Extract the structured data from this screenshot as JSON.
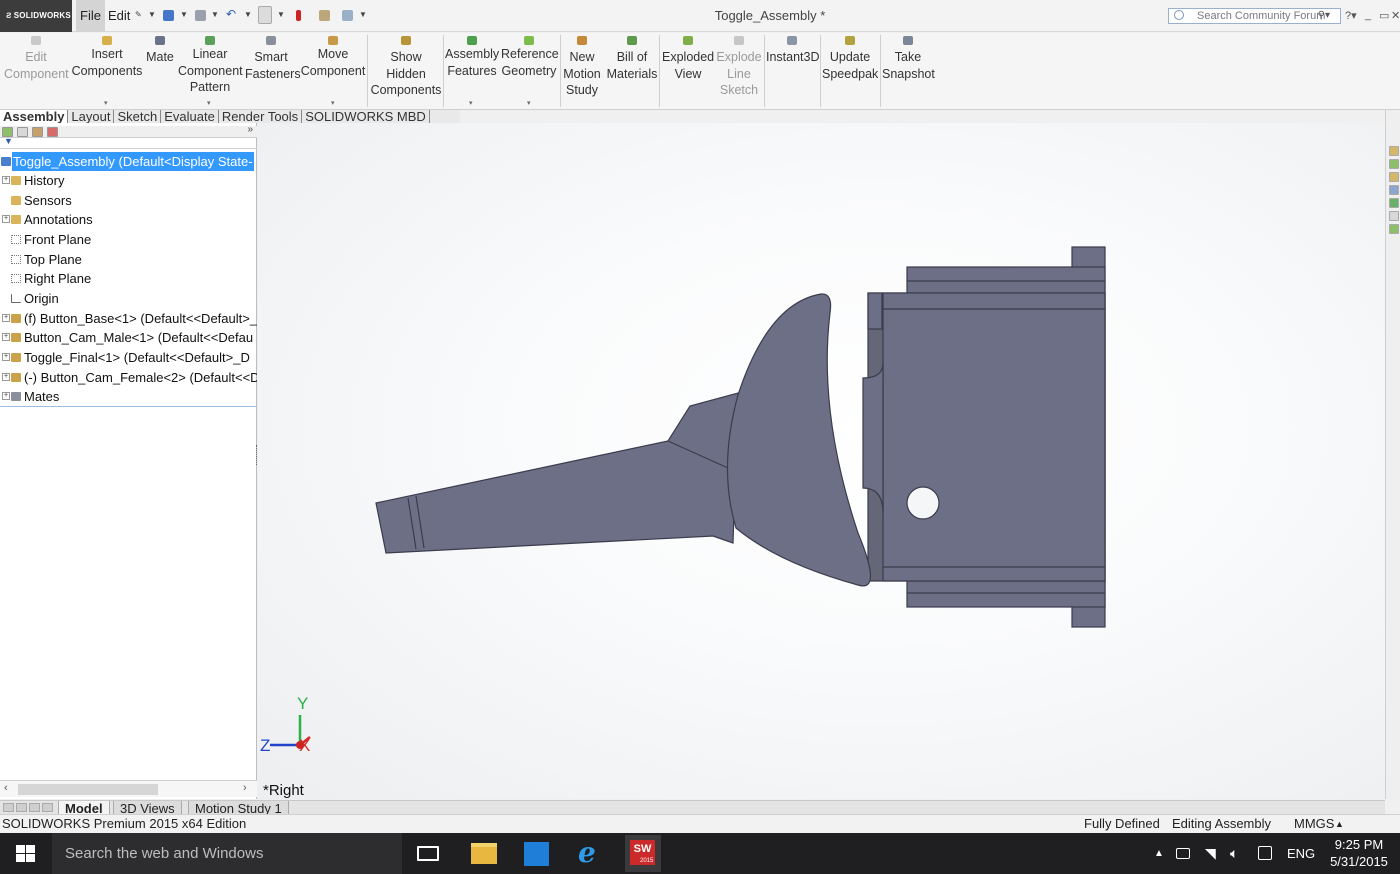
{
  "app": {
    "logo_text": "SOLIDWORKS",
    "document_title": "Toggle_Assembly *"
  },
  "menus": [
    "File",
    "Edit"
  ],
  "search": {
    "placeholder": "Search Community Forum"
  },
  "command_manager": {
    "commands": [
      {
        "label": "Edit Component",
        "enabled": false,
        "icon": "edit-component-icon"
      },
      {
        "label": "Insert Components",
        "enabled": true,
        "icon": "insert-components-icon"
      },
      {
        "label": "Mate",
        "enabled": true,
        "icon": "mate-icon"
      },
      {
        "label": "Linear Component Pattern",
        "enabled": true,
        "icon": "linear-pattern-icon"
      },
      {
        "label": "Smart Fasteners",
        "enabled": true,
        "icon": "smart-fasteners-icon"
      },
      {
        "label": "Move Component",
        "enabled": true,
        "icon": "move-component-icon"
      },
      {
        "label": "Show Hidden Components",
        "enabled": true,
        "icon": "show-hidden-icon"
      },
      {
        "label": "Assembly Features",
        "enabled": true,
        "icon": "assembly-features-icon"
      },
      {
        "label": "Reference Geometry",
        "enabled": true,
        "icon": "reference-geometry-icon"
      },
      {
        "label": "New Motion Study",
        "enabled": true,
        "icon": "motion-study-icon"
      },
      {
        "label": "Bill of Materials",
        "enabled": true,
        "icon": "bom-icon"
      },
      {
        "label": "Exploded View",
        "enabled": true,
        "icon": "exploded-view-icon"
      },
      {
        "label": "Explode Line Sketch",
        "enabled": false,
        "icon": "explode-line-icon"
      },
      {
        "label": "Instant3D",
        "enabled": true,
        "icon": "instant3d-icon"
      },
      {
        "label": "Update Speedpak",
        "enabled": true,
        "icon": "speedpak-icon"
      },
      {
        "label": "Take Snapshot",
        "enabled": true,
        "icon": "snapshot-icon"
      }
    ],
    "tabs": [
      "Assembly",
      "Layout",
      "Sketch",
      "Evaluate",
      "Render Tools",
      "SOLIDWORKS MBD"
    ],
    "active_tab": "Assembly"
  },
  "feature_tree": {
    "root": "Toggle_Assembly  (Default<Display State-",
    "items": [
      {
        "label": "History",
        "expandable": true,
        "icon": "history-folder-icon"
      },
      {
        "label": "Sensors",
        "expandable": false,
        "icon": "sensors-folder-icon"
      },
      {
        "label": "Annotations",
        "expandable": true,
        "icon": "annotations-icon"
      },
      {
        "label": "Front Plane",
        "expandable": false,
        "icon": "plane-icon"
      },
      {
        "label": "Top Plane",
        "expandable": false,
        "icon": "plane-icon"
      },
      {
        "label": "Right Plane",
        "expandable": false,
        "icon": "plane-icon"
      },
      {
        "label": "Origin",
        "expandable": false,
        "icon": "origin-icon"
      },
      {
        "label": "(f) Button_Base<1> (Default<<Default>_",
        "expandable": true,
        "icon": "part-icon"
      },
      {
        "label": "Button_Cam_Male<1> (Default<<Defau",
        "expandable": true,
        "icon": "part-icon"
      },
      {
        "label": "Toggle_Final<1> (Default<<Default>_D",
        "expandable": true,
        "icon": "part-icon"
      },
      {
        "label": "(-) Button_Cam_Female<2> (Default<<D",
        "expandable": true,
        "icon": "part-icon"
      },
      {
        "label": "Mates",
        "expandable": true,
        "icon": "mates-icon"
      }
    ]
  },
  "viewport": {
    "view_name": "*Right",
    "triad": {
      "y": "Y",
      "z": "Z",
      "x": "X"
    }
  },
  "bottom_tabs": [
    "Model",
    "3D Views",
    "Motion Study 1"
  ],
  "active_bottom_tab": "Model",
  "status": {
    "edition": "SOLIDWORKS Premium 2015 x64 Edition",
    "state": "Fully Defined",
    "mode": "Editing Assembly",
    "units": "MMGS"
  },
  "taskbar": {
    "search_placeholder": "Search the web and Windows",
    "language": "ENG",
    "time": "9:25 PM",
    "date": "5/31/2015",
    "sw_badge": "2015"
  },
  "colors": {
    "model_fill": "#6d6f86",
    "model_edge": "#3a3b4c",
    "selection": "#3399ff",
    "taskbar": "#1f1f21"
  }
}
